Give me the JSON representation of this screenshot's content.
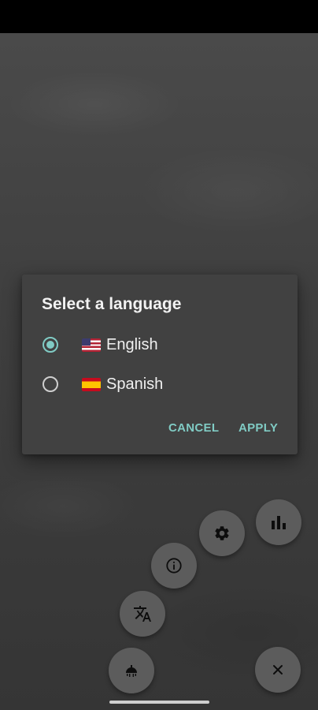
{
  "dialog": {
    "title": "Select a language",
    "options": [
      {
        "label": "English",
        "flag": "us-flag",
        "selected": true
      },
      {
        "label": "Spanish",
        "flag": "es-flag",
        "selected": false
      }
    ],
    "cancel_label": "CANCEL",
    "apply_label": "APPLY"
  },
  "fabs": [
    {
      "icon": "bar-chart-icon"
    },
    {
      "icon": "gear-icon"
    },
    {
      "icon": "info-icon"
    },
    {
      "icon": "translate-icon"
    },
    {
      "icon": "theme-icon"
    },
    {
      "icon": "close-icon"
    }
  ],
  "colors": {
    "accent": "#80cbc4",
    "dialog_bg": "#414141",
    "fab_bg": "#5c5c5c",
    "status_bar": "#000000"
  }
}
